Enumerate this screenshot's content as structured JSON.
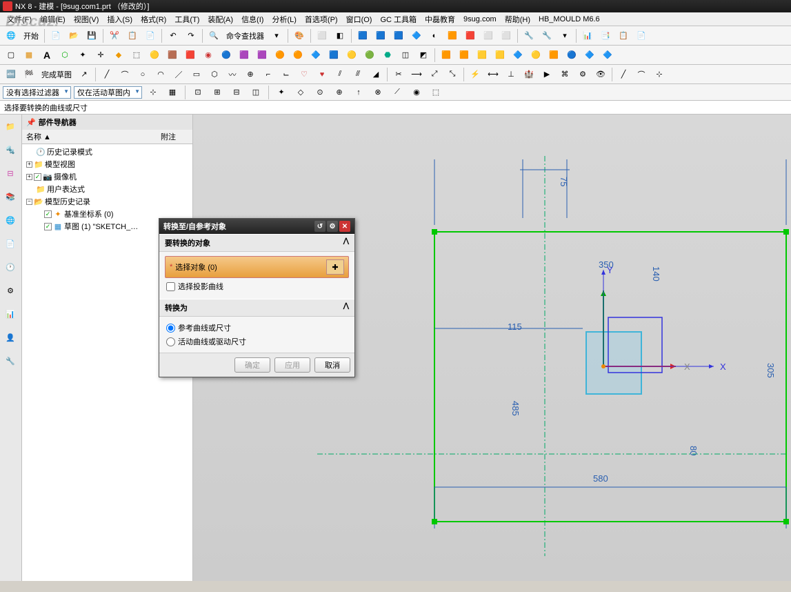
{
  "title": "NX 8 - 建模 - [9sug.com1.prt （修改的）]",
  "watermark": "Discuz!",
  "menu": {
    "file": "文件(F)",
    "edit": "编辑(E)",
    "view": "视图(V)",
    "insert": "插入(S)",
    "format": "格式(R)",
    "tools": "工具(T)",
    "assembly": "装配(A)",
    "info": "信息(I)",
    "analysis": "分析(L)",
    "preferences": "首选项(P)",
    "window": "窗口(O)",
    "gc": "GC 工具箱",
    "zhonglei": "中磊教育",
    "9sug": "9sug.com",
    "help": "帮助(H)",
    "hbmould": "HB_MOULD M6.6"
  },
  "toolbar1": {
    "start": "开始",
    "cmdfinder": "命令查找器"
  },
  "sketch_finish": "完成草图",
  "filter": {
    "no_filter": "没有选择过滤器",
    "scope": "仅在活动草图内"
  },
  "prompt": "选择要转换的曲线或尺寸",
  "navigator": {
    "title": "部件导航器",
    "col_name": "名称",
    "col_note": "附注",
    "tree": {
      "history_mode": "历史记录模式",
      "model_view": "模型视图",
      "camera": "摄像机",
      "user_expr": "用户表达式",
      "model_history": "模型历史记录",
      "datum_csys": "基准坐标系 (0)",
      "sketch": "草图 (1) \"SKETCH_…"
    }
  },
  "dialog": {
    "title": "转换至/自参考对象",
    "section1": "要转换的对象",
    "select_obj": "选择对象 (0)",
    "proj_curve": "选择投影曲线",
    "section2": "转换为",
    "opt_ref": "参考曲线或尺寸",
    "opt_active": "活动曲线或驱动尺寸",
    "ok": "确定",
    "apply": "应用",
    "cancel": "取消"
  },
  "dims": {
    "d350": "350",
    "d140": "140",
    "d115": "115",
    "d485": "485",
    "d305": "305",
    "d80": "80",
    "d580": "580",
    "d75": "75"
  },
  "axes": {
    "x": "X",
    "y": "Y"
  },
  "colors": {
    "green_line": "#00c800",
    "blue_dim": "#2a5fb0",
    "cyan_rect": "#3fb4d8",
    "red_axis": "#d22",
    "green_axis": "#0a0",
    "blue_axis": "#33d"
  }
}
